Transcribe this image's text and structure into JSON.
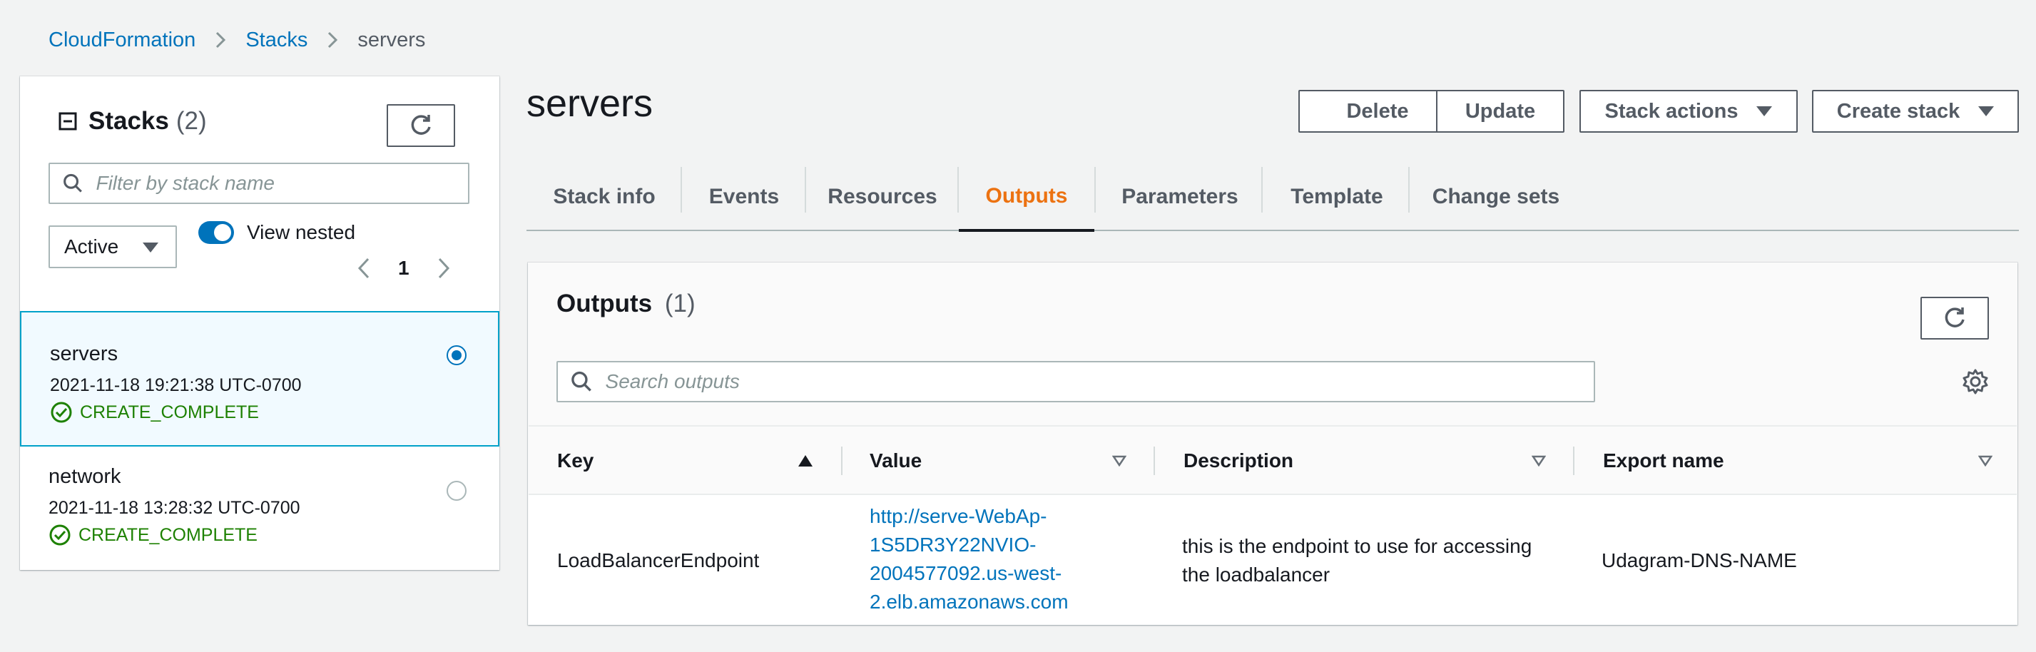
{
  "breadcrumb": {
    "items": [
      "CloudFormation",
      "Stacks"
    ],
    "current": "servers"
  },
  "stacks_panel": {
    "title": "Stacks",
    "count": "(2)",
    "filter_placeholder": "Filter by stack name",
    "status_filter": "Active",
    "view_nested_label": "View nested",
    "view_nested_on": true,
    "page": "1",
    "stacks": [
      {
        "name": "servers",
        "date": "2021-11-18 19:21:38 UTC-0700",
        "status": "CREATE_COMPLETE",
        "selected": true
      },
      {
        "name": "network",
        "date": "2021-11-18 13:28:32 UTC-0700",
        "status": "CREATE_COMPLETE",
        "selected": false
      }
    ]
  },
  "main": {
    "title": "servers",
    "actions": {
      "delete": "Delete",
      "update": "Update",
      "stack_actions": "Stack actions",
      "create_stack": "Create stack"
    },
    "tabs": [
      {
        "label": "Stack info"
      },
      {
        "label": "Events"
      },
      {
        "label": "Resources"
      },
      {
        "label": "Outputs",
        "active": true
      },
      {
        "label": "Parameters"
      },
      {
        "label": "Template"
      },
      {
        "label": "Change sets"
      }
    ],
    "outputs": {
      "title": "Outputs",
      "count": "(1)",
      "search_placeholder": "Search outputs",
      "columns": [
        "Key",
        "Value",
        "Description",
        "Export name"
      ],
      "rows": [
        {
          "key": "LoadBalancerEndpoint",
          "value_lines": [
            "http://serve-WebAp-",
            "1S5DR3Y22NVIO-",
            "2004577092.us-west-",
            "2.elb.amazonaws.com"
          ],
          "description_lines": [
            "this is the endpoint to use for accessing",
            "the loadbalancer"
          ],
          "export_name": "Udagram-DNS-NAME"
        }
      ]
    }
  },
  "colors": {
    "link": "#0073bb",
    "accent_tab": "#ec7211",
    "success": "#1d8102",
    "selected_border": "#00a1c9"
  }
}
